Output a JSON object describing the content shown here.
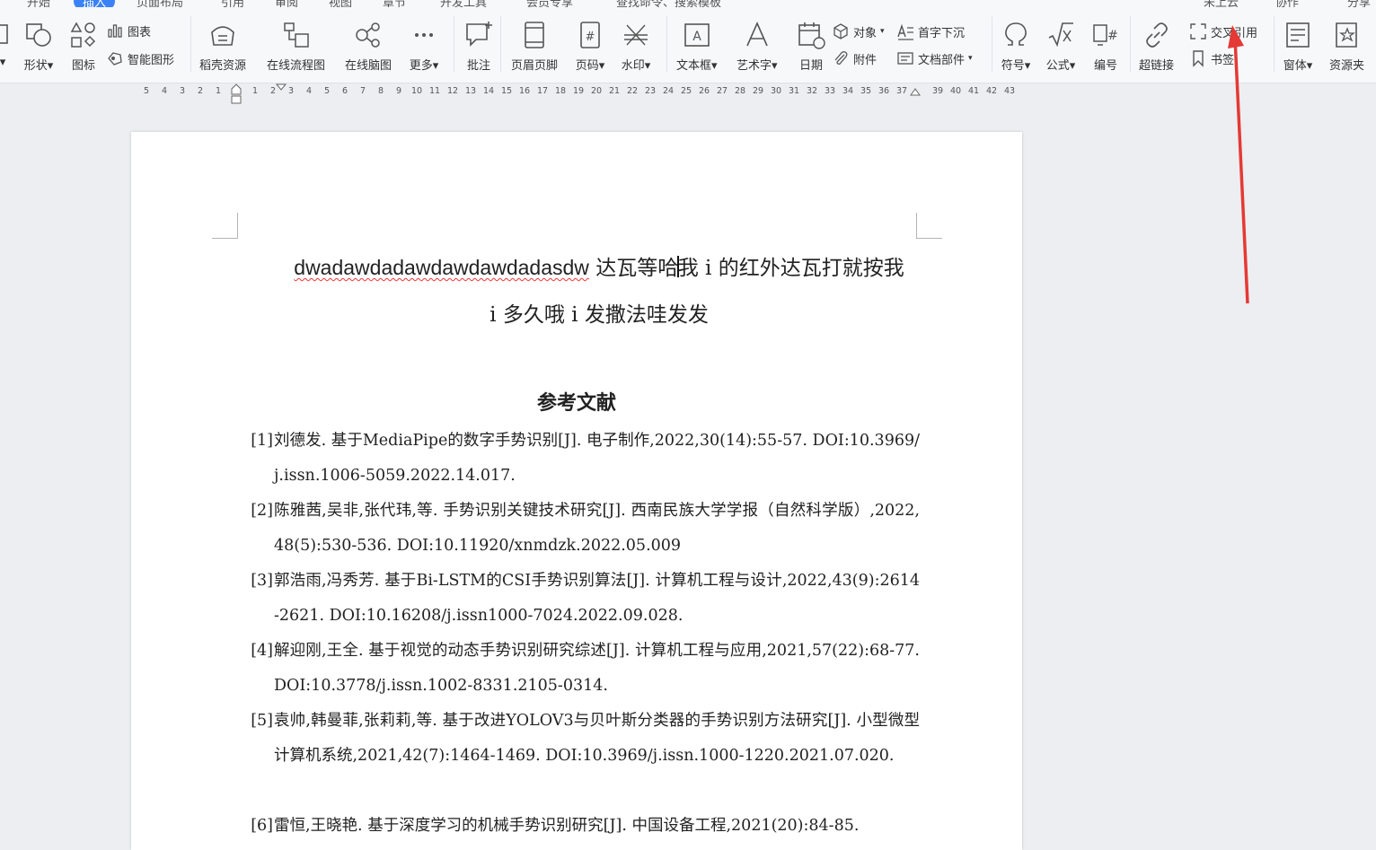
{
  "tabs": {
    "items": [
      "开始",
      "插入",
      "页面布局",
      "引用",
      "审阅",
      "视图",
      "章节",
      "开发工具",
      "会员专享",
      "查找命令、搜索模板",
      "未上云",
      "协作",
      "分享"
    ]
  },
  "ribbon": {
    "shape": "形状",
    "icon": "图标",
    "chart": "图表",
    "smart_graphic": "智能图形",
    "docer_resource": "稻壳资源",
    "online_flowchart": "在线流程图",
    "online_mindmap": "在线脑图",
    "more": "更多",
    "comment": "批注",
    "header_footer": "页眉页脚",
    "page_number": "页码",
    "watermark": "水印",
    "textbox": "文本框",
    "wordart": "艺术字",
    "date": "日期",
    "object": "对象",
    "attachment": "附件",
    "drop_cap": "首字下沉",
    "doc_parts": "文档部件",
    "symbol": "符号",
    "formula": "公式",
    "numbering": "编号",
    "hyperlink": "超链接",
    "cross_reference": "交叉引用",
    "bookmark": "书签",
    "form": "窗体",
    "resource_clip": "资源夹"
  },
  "ruler": {
    "left_numbers": [
      "5",
      "4",
      "3",
      "2",
      "1"
    ],
    "right_numbers": [
      "1",
      "2",
      "3",
      "4",
      "5",
      "6",
      "7",
      "8",
      "9",
      "10",
      "11",
      "12",
      "13",
      "14",
      "15",
      "16",
      "17",
      "18",
      "19",
      "20",
      "21",
      "22",
      "23",
      "24",
      "25",
      "26",
      "27",
      "28",
      "29",
      "30",
      "31",
      "32",
      "33",
      "34",
      "35",
      "36",
      "37",
      "39",
      "40",
      "41",
      "42",
      "43"
    ]
  },
  "document": {
    "title_latin": "dwadawdadawdawdawdadasdw",
    "title_before_cursor": " 达瓦等哈",
    "title_after_cursor": "我 i 的红外达瓦打就按我",
    "title_line2": "i 多久哦 i 发撒法哇发发",
    "references_heading": "参考文献",
    "references": [
      {
        "num": "[1]",
        "text": "刘德发. 基于MediaPipe的数字手势识别[J]. 电子制作,2022,30(14):55-57. DOI:10.3969/j.issn.1006-5059.2022.14.017."
      },
      {
        "num": "[2]",
        "text": "陈雅茜,吴非,张代玮,等. 手势识别关键技术研究[J]. 西南民族大学学报（自然科学版）,2022,48(5):530-536. DOI:10.11920/xnmdzk.2022.05.009"
      },
      {
        "num": "[3]",
        "text": "郭浩雨,冯秀芳. 基于Bi-LSTM的CSI手势识别算法[J]. 计算机工程与设计,2022,43(9):2614-2621. DOI:10.16208/j.issn1000-7024.2022.09.028."
      },
      {
        "num": "[4]",
        "text": "解迎刚,王全. 基于视觉的动态手势识别研究综述[J]. 计算机工程与应用,2021,57(22):68-77. DOI:10.3778/j.issn.1002-8331.2105-0314."
      },
      {
        "num": "[5]",
        "text": "袁帅,韩曼菲,张莉莉,等. 基于改进YOLOV3与贝叶斯分类器的手势识别方法研究[J]. 小型微型计算机系统,2021,42(7):1464-1469. DOI:10.3969/j.issn.1000-1220.2021.07.020."
      },
      {
        "num": "[6]",
        "text": "雷恒,王晓艳. 基于深度学习的机械手势识别研究[J]. 中国设备工程,2021(20):84-85."
      }
    ]
  },
  "colors": {
    "annotation_arrow": "#e53935",
    "accent": "#3b82f6"
  }
}
